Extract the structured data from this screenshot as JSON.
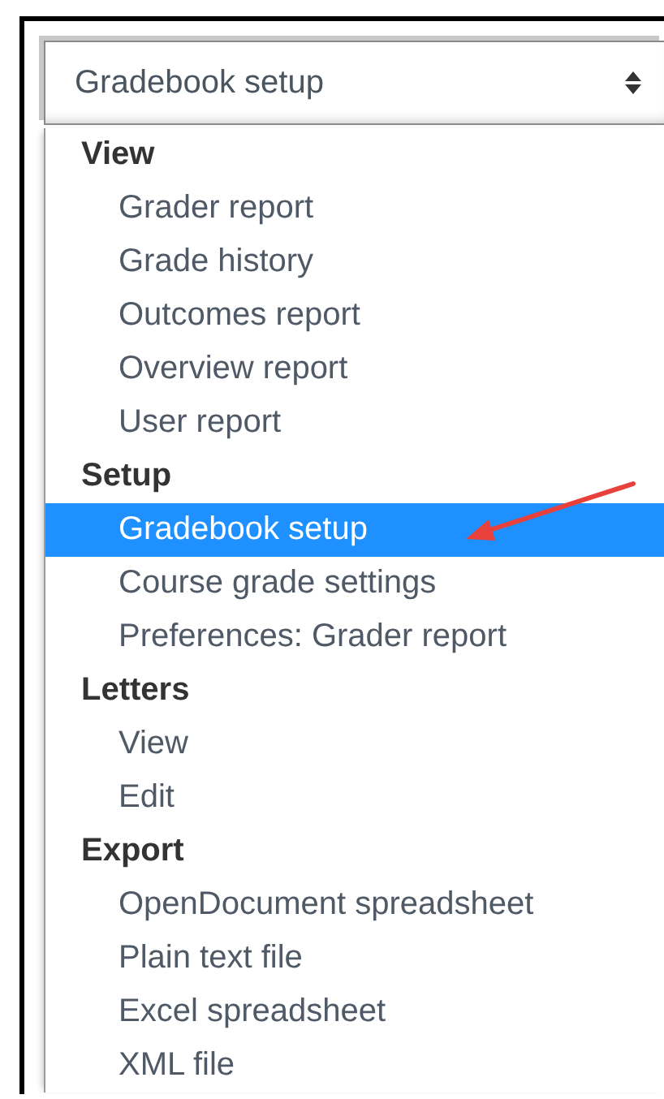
{
  "select": {
    "value": "Gradebook setup"
  },
  "groups": [
    {
      "label": "View",
      "options": [
        {
          "label": "Grader report",
          "selected": false
        },
        {
          "label": "Grade history",
          "selected": false
        },
        {
          "label": "Outcomes report",
          "selected": false
        },
        {
          "label": "Overview report",
          "selected": false
        },
        {
          "label": "User report",
          "selected": false
        }
      ]
    },
    {
      "label": "Setup",
      "options": [
        {
          "label": "Gradebook setup",
          "selected": true
        },
        {
          "label": "Course grade settings",
          "selected": false
        },
        {
          "label": "Preferences: Grader report",
          "selected": false
        }
      ]
    },
    {
      "label": "Letters",
      "options": [
        {
          "label": "View",
          "selected": false
        },
        {
          "label": "Edit",
          "selected": false
        }
      ]
    },
    {
      "label": "Export",
      "options": [
        {
          "label": "OpenDocument spreadsheet",
          "selected": false
        },
        {
          "label": "Plain text file",
          "selected": false
        },
        {
          "label": "Excel spreadsheet",
          "selected": false
        },
        {
          "label": "XML file",
          "selected": false
        }
      ]
    }
  ]
}
